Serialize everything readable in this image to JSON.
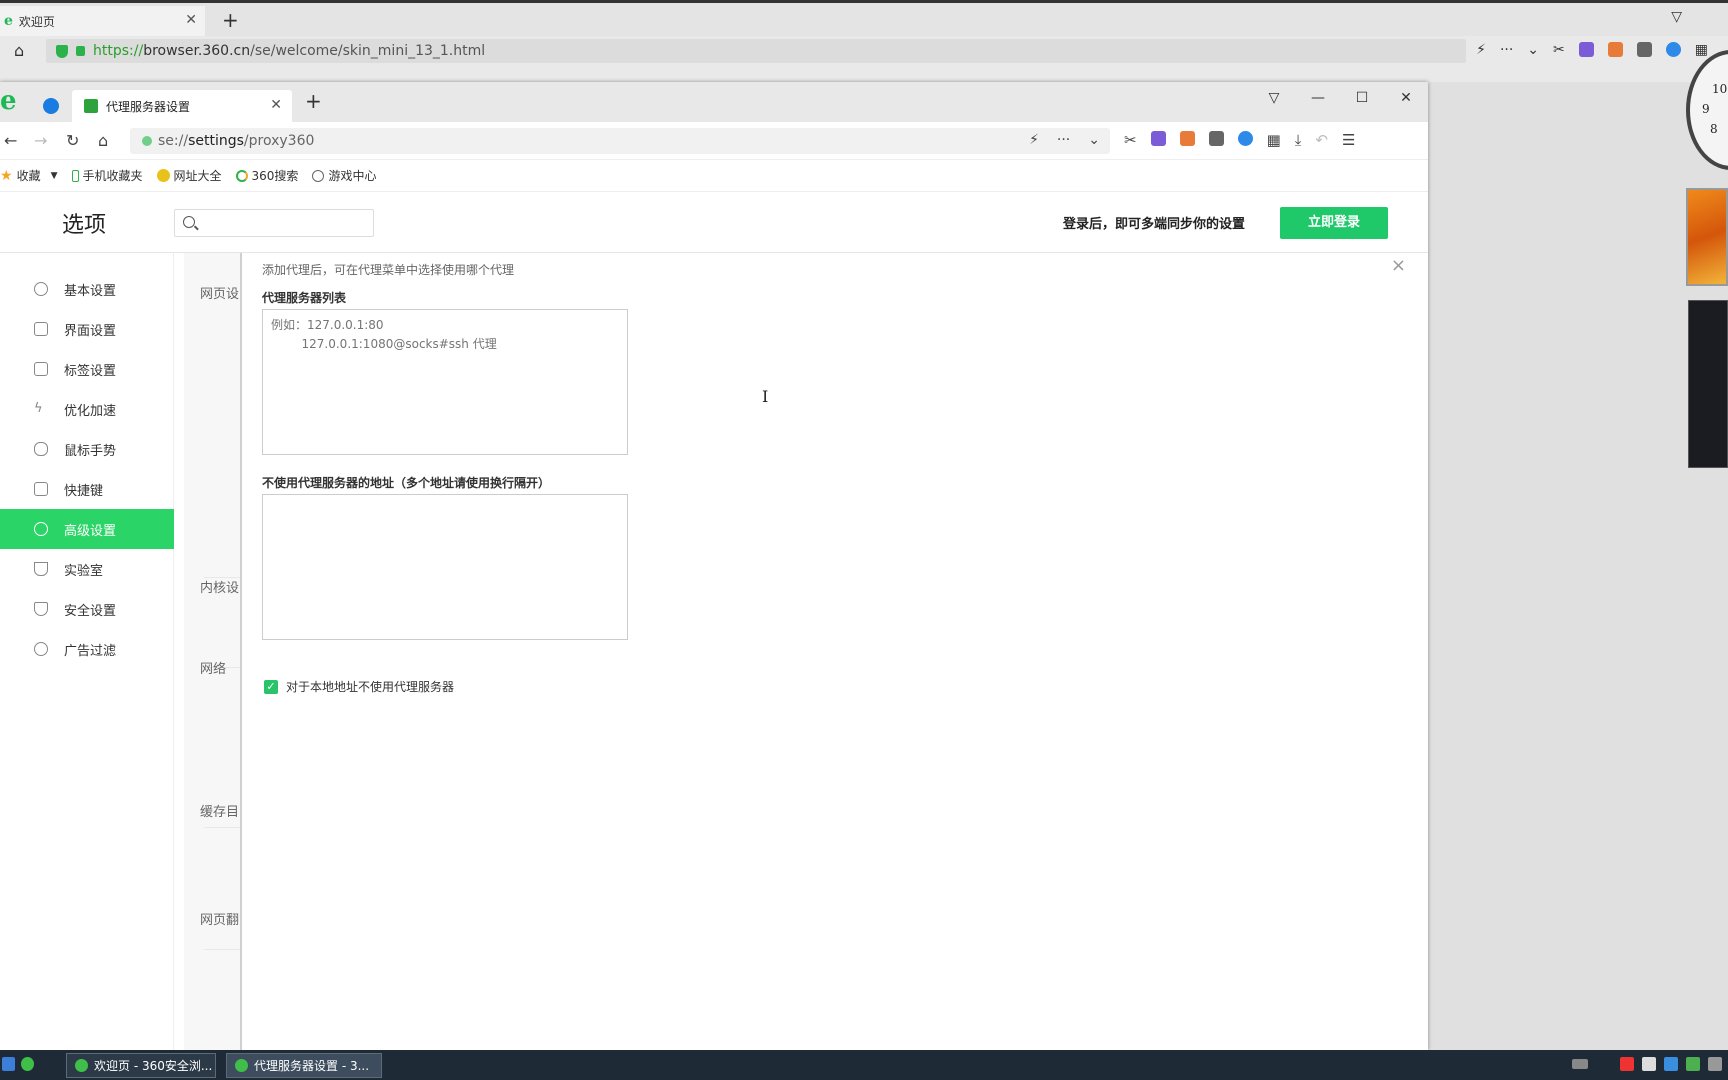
{
  "outer_browser": {
    "tab_title": "欢迎页",
    "url_scheme": "https://",
    "url_host": "browser.360.cn",
    "url_path": "/se/welcome/skin_mini_13_1.html"
  },
  "window": {
    "tab_title": "代理服务器设置",
    "url_scheme": "se://",
    "url_host": "settings",
    "url_path": "/proxy360"
  },
  "bookmarks": [
    {
      "label": "收藏",
      "icon": "star-icon"
    },
    {
      "label": "手机收藏夹",
      "icon": "phone-icon"
    },
    {
      "label": "网址大全",
      "icon": "sites-icon"
    },
    {
      "label": "360搜索",
      "icon": "search-360-icon"
    },
    {
      "label": "游戏中心",
      "icon": "globe-icon"
    }
  ],
  "settings": {
    "title": "选项",
    "search_placeholder": "",
    "login_tip": "登录后，即可多端同步你的设置",
    "login_button": "立即登录"
  },
  "sidebar": {
    "items": [
      {
        "label": "基本设置",
        "icon": "gear-icon"
      },
      {
        "label": "界面设置",
        "icon": "window-icon"
      },
      {
        "label": "标签设置",
        "icon": "tab-icon"
      },
      {
        "label": "优化加速",
        "icon": "lightning-icon"
      },
      {
        "label": "鼠标手势",
        "icon": "mouse-icon"
      },
      {
        "label": "快捷键",
        "icon": "keyboard-icon"
      },
      {
        "label": "高级设置",
        "icon": "wrench-icon"
      },
      {
        "label": "实验室",
        "icon": "flask-icon"
      },
      {
        "label": "安全设置",
        "icon": "shield-icon"
      },
      {
        "label": "广告过滤",
        "icon": "block-icon"
      }
    ],
    "active_index": 6
  },
  "underlying": {
    "labels": [
      "网页设",
      "内核设",
      "网络",
      "缓存目",
      "网页翻"
    ]
  },
  "dialog": {
    "tip": "添加代理后，可在代理菜单中选择使用哪个代理",
    "list_label": "代理服务器列表",
    "list_placeholder": "例如：127.0.0.1:80\n        127.0.0.1:1080@socks#ssh 代理",
    "bypass_label": "不使用代理服务器的地址（多个地址请使用换行隔开）",
    "bypass_value": "",
    "local_checkbox_label": "对于本地地址不使用代理服务器",
    "local_checkbox_checked": true
  },
  "taskbar": {
    "buttons": [
      "欢迎页 - 360安全浏...",
      "代理服务器设置 - 3..."
    ]
  },
  "desktop": {
    "clock_numbers": [
      "10",
      "9",
      "8"
    ]
  },
  "colors": {
    "accent_green": "#1fc96a",
    "sidebar_active": "#2bd466"
  }
}
